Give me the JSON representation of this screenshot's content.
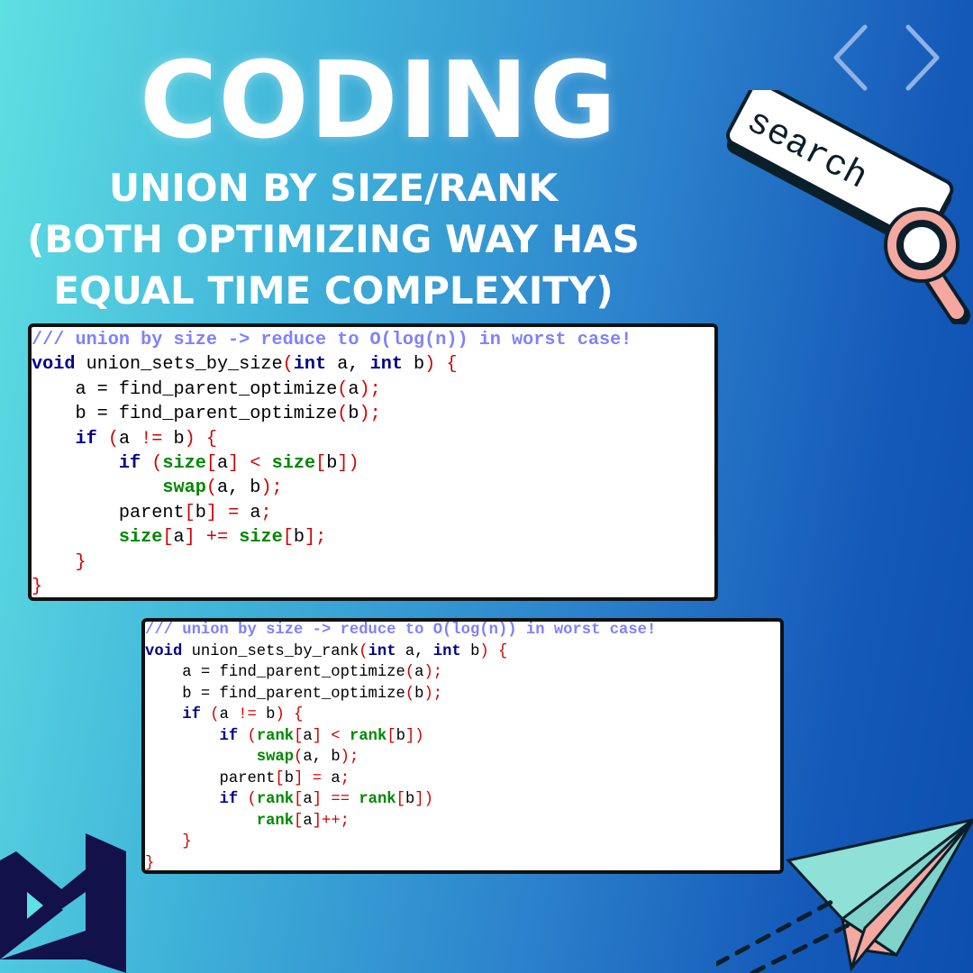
{
  "title": "CODING",
  "subtitle": {
    "line1": "UNION BY SIZE/RANK",
    "line2": "(BOTH OPTIMIZING WAY HAS",
    "line3": "EQUAL TIME COMPLEXITY)"
  },
  "search_label": "search",
  "colors": {
    "comment": "#8080ff",
    "keyword": "#00008b",
    "function": "#008800",
    "punctuation": "#d00000",
    "logo": "#12114a"
  },
  "icons": [
    "code-brackets-icon",
    "search-bar-icon",
    "magnifier-icon",
    "visual-studio-logo",
    "paper-plane-icon"
  ],
  "code_size": {
    "comment": "/// union by size -> reduce to O(log(n)) in worst case!",
    "signature": {
      "kw": "void",
      "name": "union_sets_by_size",
      "params": [
        "int",
        "a, ",
        "int",
        "b"
      ]
    },
    "line_a": "a = find_parent_optimize",
    "line_b": "b = find_parent_optimize",
    "if_kw": "if",
    "cond": "a != b",
    "inner_if_left": "size",
    "inner_if_right": "size",
    "swap": "swap",
    "swap_args": "a, b",
    "parent_assign": "parent",
    "size_add_left": "size",
    "size_add_right": "size"
  },
  "code_rank": {
    "comment": "/// union by size -> reduce to O(log(n)) in worst case!",
    "name": "union_sets_by_rank",
    "rank": "rank"
  }
}
